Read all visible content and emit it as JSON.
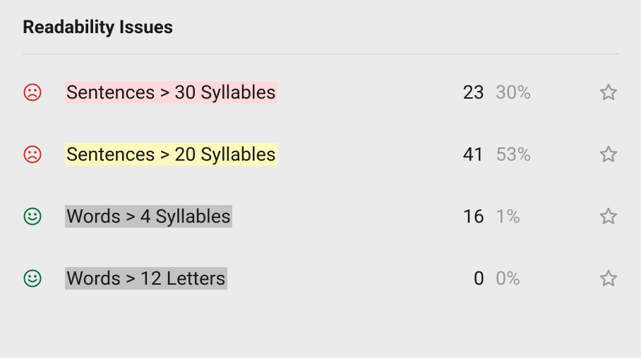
{
  "panel": {
    "title": "Readability Issues"
  },
  "issues": [
    {
      "status": "sad",
      "highlight": "pink",
      "label": "Sentences > 30 Syllables",
      "count": "23",
      "percent": "30%"
    },
    {
      "status": "sad",
      "highlight": "yellow",
      "label": "Sentences > 20 Syllables",
      "count": "41",
      "percent": "53%"
    },
    {
      "status": "happy",
      "highlight": "grey",
      "label": "Words > 4 Syllables",
      "count": "16",
      "percent": "1%"
    },
    {
      "status": "happy",
      "highlight": "grey",
      "label": "Words > 12 Letters",
      "count": "0",
      "percent": "0%"
    }
  ],
  "colors": {
    "sad": "#c63030",
    "happy": "#0c6b3d",
    "star": "#9a9a9a"
  }
}
